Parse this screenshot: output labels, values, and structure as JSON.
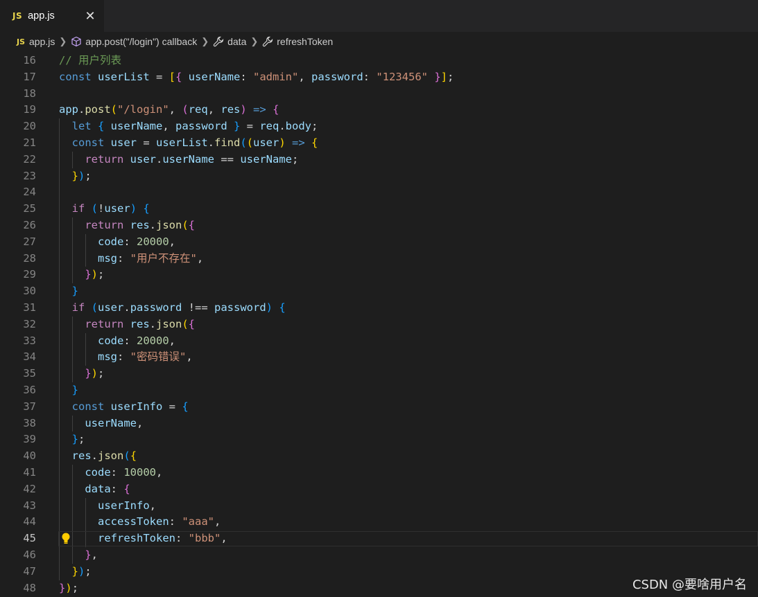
{
  "tab": {
    "icon_text": "JS",
    "label": "app.js",
    "close_icon": "close-icon"
  },
  "breadcrumb": {
    "items": [
      {
        "icon": "js-file-icon",
        "icon_text": "JS",
        "label": "app.js"
      },
      {
        "icon": "method-cube-icon",
        "label": "app.post(\"/login\") callback"
      },
      {
        "icon": "wrench-property-icon",
        "label": "data"
      },
      {
        "icon": "wrench-property-icon",
        "label": "refreshToken"
      }
    ]
  },
  "editor": {
    "active_line": 45,
    "lines": [
      {
        "n": "16",
        "t": [
          [
            "cm",
            "// 用户列表"
          ]
        ]
      },
      {
        "n": "17",
        "t": [
          [
            "kw",
            "const "
          ],
          [
            "var",
            "userList"
          ],
          [
            "op",
            " = "
          ],
          [
            "p1",
            "["
          ],
          [
            "p2",
            "{ "
          ],
          [
            "var",
            "userName"
          ],
          [
            "op",
            ": "
          ],
          [
            "str",
            "\"admin\""
          ],
          [
            "op",
            ", "
          ],
          [
            "var",
            "password"
          ],
          [
            "op",
            ": "
          ],
          [
            "str",
            "\"123456\""
          ],
          [
            "p2",
            " }"
          ],
          [
            "p1",
            "]"
          ],
          [
            "op",
            ";"
          ]
        ]
      },
      {
        "n": "18",
        "t": []
      },
      {
        "n": "19",
        "t": [
          [
            "var",
            "app"
          ],
          [
            "op",
            "."
          ],
          [
            "fn",
            "post"
          ],
          [
            "p1",
            "("
          ],
          [
            "str",
            "\"/login\""
          ],
          [
            "op",
            ", "
          ],
          [
            "p2",
            "("
          ],
          [
            "var",
            "req"
          ],
          [
            "op",
            ", "
          ],
          [
            "var",
            "res"
          ],
          [
            "p2",
            ")"
          ],
          [
            "op",
            " "
          ],
          [
            "kw",
            "=>"
          ],
          [
            "op",
            " "
          ],
          [
            "p2",
            "{"
          ]
        ]
      },
      {
        "n": "20",
        "t": [
          [
            "op",
            "  "
          ],
          [
            "kw",
            "let "
          ],
          [
            "p3",
            "{ "
          ],
          [
            "var",
            "userName"
          ],
          [
            "op",
            ", "
          ],
          [
            "var",
            "password"
          ],
          [
            "p3",
            " }"
          ],
          [
            "op",
            " = "
          ],
          [
            "var",
            "req"
          ],
          [
            "op",
            "."
          ],
          [
            "var",
            "body"
          ],
          [
            "op",
            ";"
          ]
        ]
      },
      {
        "n": "21",
        "t": [
          [
            "op",
            "  "
          ],
          [
            "kw",
            "const "
          ],
          [
            "var",
            "user"
          ],
          [
            "op",
            " = "
          ],
          [
            "var",
            "userList"
          ],
          [
            "op",
            "."
          ],
          [
            "fn",
            "find"
          ],
          [
            "p3",
            "("
          ],
          [
            "p1",
            "("
          ],
          [
            "var",
            "user"
          ],
          [
            "p1",
            ")"
          ],
          [
            "op",
            " "
          ],
          [
            "kw",
            "=>"
          ],
          [
            "op",
            " "
          ],
          [
            "p1",
            "{"
          ]
        ]
      },
      {
        "n": "22",
        "t": [
          [
            "op",
            "    "
          ],
          [
            "ctl",
            "return "
          ],
          [
            "var",
            "user"
          ],
          [
            "op",
            "."
          ],
          [
            "var",
            "userName"
          ],
          [
            "op",
            " == "
          ],
          [
            "var",
            "userName"
          ],
          [
            "op",
            ";"
          ]
        ]
      },
      {
        "n": "23",
        "t": [
          [
            "op",
            "  "
          ],
          [
            "p1",
            "}"
          ],
          [
            "p3",
            ")"
          ],
          [
            "op",
            ";"
          ]
        ]
      },
      {
        "n": "24",
        "t": []
      },
      {
        "n": "25",
        "t": [
          [
            "op",
            "  "
          ],
          [
            "ctl",
            "if "
          ],
          [
            "p3",
            "("
          ],
          [
            "op",
            "!"
          ],
          [
            "var",
            "user"
          ],
          [
            "p3",
            ")"
          ],
          [
            "op",
            " "
          ],
          [
            "p3",
            "{"
          ]
        ]
      },
      {
        "n": "26",
        "t": [
          [
            "op",
            "    "
          ],
          [
            "ctl",
            "return "
          ],
          [
            "var",
            "res"
          ],
          [
            "op",
            "."
          ],
          [
            "fn",
            "json"
          ],
          [
            "p1",
            "("
          ],
          [
            "p2",
            "{"
          ]
        ]
      },
      {
        "n": "27",
        "t": [
          [
            "op",
            "      "
          ],
          [
            "var",
            "code"
          ],
          [
            "op",
            ": "
          ],
          [
            "num",
            "20000"
          ],
          [
            "op",
            ","
          ]
        ]
      },
      {
        "n": "28",
        "t": [
          [
            "op",
            "      "
          ],
          [
            "var",
            "msg"
          ],
          [
            "op",
            ": "
          ],
          [
            "str",
            "\"用户不存在\""
          ],
          [
            "op",
            ","
          ]
        ]
      },
      {
        "n": "29",
        "t": [
          [
            "op",
            "    "
          ],
          [
            "p2",
            "}"
          ],
          [
            "p1",
            ")"
          ],
          [
            "op",
            ";"
          ]
        ]
      },
      {
        "n": "30",
        "t": [
          [
            "op",
            "  "
          ],
          [
            "p3",
            "}"
          ]
        ]
      },
      {
        "n": "31",
        "t": [
          [
            "op",
            "  "
          ],
          [
            "ctl",
            "if "
          ],
          [
            "p3",
            "("
          ],
          [
            "var",
            "user"
          ],
          [
            "op",
            "."
          ],
          [
            "var",
            "password"
          ],
          [
            "op",
            " !== "
          ],
          [
            "var",
            "password"
          ],
          [
            "p3",
            ")"
          ],
          [
            "op",
            " "
          ],
          [
            "p3",
            "{"
          ]
        ]
      },
      {
        "n": "32",
        "t": [
          [
            "op",
            "    "
          ],
          [
            "ctl",
            "return "
          ],
          [
            "var",
            "res"
          ],
          [
            "op",
            "."
          ],
          [
            "fn",
            "json"
          ],
          [
            "p1",
            "("
          ],
          [
            "p2",
            "{"
          ]
        ]
      },
      {
        "n": "33",
        "t": [
          [
            "op",
            "      "
          ],
          [
            "var",
            "code"
          ],
          [
            "op",
            ": "
          ],
          [
            "num",
            "20000"
          ],
          [
            "op",
            ","
          ]
        ]
      },
      {
        "n": "34",
        "t": [
          [
            "op",
            "      "
          ],
          [
            "var",
            "msg"
          ],
          [
            "op",
            ": "
          ],
          [
            "str",
            "\"密码错误\""
          ],
          [
            "op",
            ","
          ]
        ]
      },
      {
        "n": "35",
        "t": [
          [
            "op",
            "    "
          ],
          [
            "p2",
            "}"
          ],
          [
            "p1",
            ")"
          ],
          [
            "op",
            ";"
          ]
        ]
      },
      {
        "n": "36",
        "t": [
          [
            "op",
            "  "
          ],
          [
            "p3",
            "}"
          ]
        ]
      },
      {
        "n": "37",
        "t": [
          [
            "op",
            "  "
          ],
          [
            "kw",
            "const "
          ],
          [
            "var",
            "userInfo"
          ],
          [
            "op",
            " = "
          ],
          [
            "p3",
            "{"
          ]
        ]
      },
      {
        "n": "38",
        "t": [
          [
            "op",
            "    "
          ],
          [
            "var",
            "userName"
          ],
          [
            "op",
            ","
          ]
        ]
      },
      {
        "n": "39",
        "t": [
          [
            "op",
            "  "
          ],
          [
            "p3",
            "}"
          ],
          [
            "op",
            ";"
          ]
        ]
      },
      {
        "n": "40",
        "t": [
          [
            "op",
            "  "
          ],
          [
            "var",
            "res"
          ],
          [
            "op",
            "."
          ],
          [
            "fn",
            "json"
          ],
          [
            "p3",
            "("
          ],
          [
            "p1",
            "{"
          ]
        ]
      },
      {
        "n": "41",
        "t": [
          [
            "op",
            "    "
          ],
          [
            "var",
            "code"
          ],
          [
            "op",
            ": "
          ],
          [
            "num",
            "10000"
          ],
          [
            "op",
            ","
          ]
        ]
      },
      {
        "n": "42",
        "t": [
          [
            "op",
            "    "
          ],
          [
            "var",
            "data"
          ],
          [
            "op",
            ": "
          ],
          [
            "p2",
            "{"
          ]
        ]
      },
      {
        "n": "43",
        "t": [
          [
            "op",
            "      "
          ],
          [
            "var",
            "userInfo"
          ],
          [
            "op",
            ","
          ]
        ]
      },
      {
        "n": "44",
        "t": [
          [
            "op",
            "      "
          ],
          [
            "var",
            "accessToken"
          ],
          [
            "op",
            ": "
          ],
          [
            "str",
            "\"aaa\""
          ],
          [
            "op",
            ","
          ]
        ]
      },
      {
        "n": "45",
        "t": [
          [
            "op",
            "      "
          ],
          [
            "var",
            "refreshToken"
          ],
          [
            "op",
            ": "
          ],
          [
            "str",
            "\"bbb\""
          ],
          [
            "op",
            ","
          ]
        ]
      },
      {
        "n": "46",
        "t": [
          [
            "op",
            "    "
          ],
          [
            "p2",
            "}"
          ],
          [
            "op",
            ","
          ]
        ]
      },
      {
        "n": "47",
        "t": [
          [
            "op",
            "  "
          ],
          [
            "p1",
            "}"
          ],
          [
            "p3",
            ")"
          ],
          [
            "op",
            ";"
          ]
        ]
      },
      {
        "n": "48",
        "t": [
          [
            "p2",
            "}"
          ],
          [
            "p1",
            ")"
          ],
          [
            "op",
            ";"
          ]
        ]
      }
    ]
  },
  "watermark": "CSDN @要啥用户名",
  "colors": {
    "background": "#1e1e1e",
    "tabbar": "#252526",
    "keyword": "#569cd6",
    "control": "#c586c0",
    "variable": "#9cdcfe",
    "function": "#dcdcaa",
    "string": "#ce9178",
    "number": "#b5cea8",
    "comment": "#6a9955"
  }
}
